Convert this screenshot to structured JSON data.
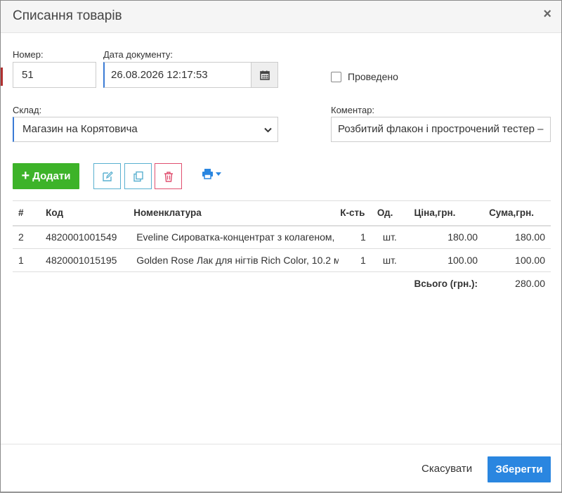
{
  "dialog": {
    "title": "Списання товарів",
    "close_glyph": "×"
  },
  "form": {
    "number_label": "Номер:",
    "number_value": "51",
    "date_label": "Дата документу:",
    "date_value": "26.08.2026 12:17:53",
    "posted_label": "Проведено",
    "posted_checked": false,
    "warehouse_label": "Склад:",
    "warehouse_value": "Магазин на Корятовича",
    "comment_label": "Коментар:",
    "comment_value": "Розбитий флакон і прострочений тестер –"
  },
  "toolbar": {
    "add_label": "Додати",
    "icons": [
      "edit-icon",
      "copy-icon",
      "trash-icon",
      "print-icon"
    ]
  },
  "table": {
    "headers": {
      "num": "#",
      "code": "Код",
      "name": "Номенклатура",
      "qty": "К-сть",
      "unit": "Од.",
      "price": "Ціна,грн.",
      "sum": "Сума,грн."
    },
    "rows": [
      {
        "num": "2",
        "code": "4820001001549",
        "name": "Eveline Сироватка-концентрат з колагеном,",
        "qty": "1",
        "unit": "шт.",
        "price": "180.00",
        "sum": "180.00"
      },
      {
        "num": "1",
        "code": "4820001015195",
        "name": "Golden Rose Лак для нігтів Rich Color, 10.2 м",
        "qty": "1",
        "unit": "шт.",
        "price": "100.00",
        "sum": "100.00"
      }
    ],
    "total_label": "Всього (грн.):",
    "total_value": "280.00"
  },
  "footer": {
    "cancel_label": "Скасувати",
    "save_label": "Зберегти"
  },
  "colors": {
    "add": "#3db329",
    "save": "#2a86e0",
    "icon_blue": "#5ab0d0",
    "icon_red": "#e05070",
    "print": "#2a86e0"
  }
}
